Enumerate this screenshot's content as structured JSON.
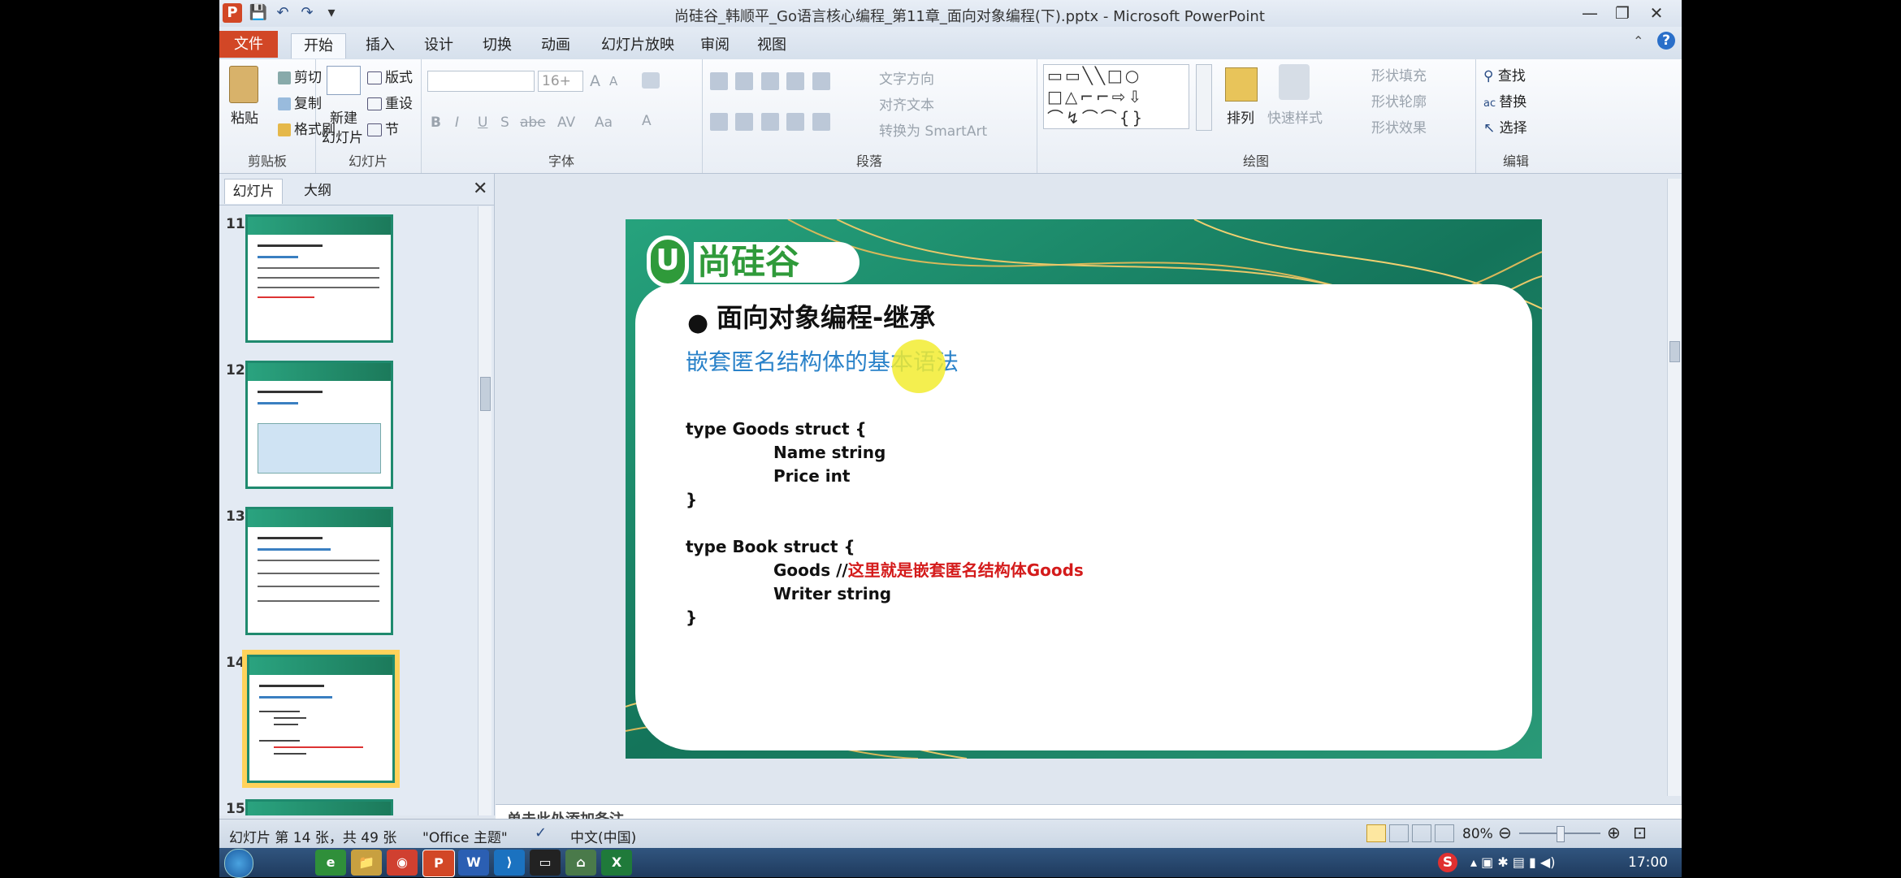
{
  "window": {
    "title": "尚硅谷_韩顺平_Go语言核心编程_第11章_面向对象编程(下).pptx - Microsoft PowerPoint",
    "controls": {
      "minimize": "—",
      "maximize": "❐",
      "close": "✕"
    }
  },
  "quick_access": {
    "app_icon": "P",
    "save": "💾",
    "undo": "↶",
    "redo": "↷",
    "more": "▾"
  },
  "tabs": [
    "文件",
    "开始",
    "插入",
    "设计",
    "切换",
    "动画",
    "幻灯片放映",
    "审阅",
    "视图"
  ],
  "active_tab": "开始",
  "ribbon": {
    "clipboard": {
      "paste": "粘贴",
      "cut": "剪切",
      "copy": "复制",
      "format_painter": "格式刷",
      "label": "剪贴板"
    },
    "slides": {
      "new_slide_1": "新建",
      "new_slide_2": "幻灯片",
      "layout": "版式",
      "reset": "重设",
      "section": "节",
      "label": "幻灯片"
    },
    "font": {
      "size": "16+",
      "grow": "A",
      "shrink": "A",
      "bold": "B",
      "italic": "I",
      "underline": "U",
      "shadow": "S",
      "strike": "abe",
      "spacing": "AV",
      "case": "Aa",
      "color": "A",
      "label": "字体"
    },
    "paragraph": {
      "text_direction": "文字方向",
      "align_text": "对齐文本",
      "smartart": "转换为 SmartArt",
      "label": "段落"
    },
    "drawing": {
      "arrange": "排列",
      "quick_styles": "快速样式",
      "fill": "形状填充",
      "outline": "形状轮廓",
      "effects": "形状效果",
      "label": "绘图"
    },
    "editing": {
      "find": "查找",
      "replace": "替换",
      "select": "选择",
      "label": "编辑"
    }
  },
  "pane_tabs": [
    "幻灯片",
    "大纲"
  ],
  "thumbnails": [
    {
      "num": "11",
      "selected": false,
      "accent": "#3a7fc1"
    },
    {
      "num": "12",
      "selected": false,
      "accent": "#3a7fc1"
    },
    {
      "num": "13",
      "selected": false,
      "accent": "#3a7fc1"
    },
    {
      "num": "14",
      "selected": true,
      "accent": "#e03030"
    },
    {
      "num": "15",
      "selected": false,
      "accent": "#3a7fc1"
    }
  ],
  "slide": {
    "logo": "尚硅谷",
    "logo_letter": "U",
    "bullet": "面向对象编程-继承",
    "subtitle": "嵌套匿名结构体的基本语法",
    "code": [
      {
        "text": "type Goods struct {",
        "indent": 0
      },
      {
        "text": "Name string",
        "indent": 1
      },
      {
        "text": "Price int",
        "indent": 1
      },
      {
        "text": "}",
        "indent": 0
      },
      {
        "text": "",
        "indent": 0
      },
      {
        "text": "type Book struct {",
        "indent": 0
      },
      {
        "text": "Goods  //",
        "indent": 1,
        "comment": "这里就是嵌套匿名结构体Goods"
      },
      {
        "text": "Writer string",
        "indent": 1
      },
      {
        "text": "}",
        "indent": 0
      }
    ],
    "colors": {
      "green": "#1d8f70",
      "blue": "#2a82c9",
      "red": "#d41b1b"
    }
  },
  "notes": "单击此处添加备注",
  "status": {
    "slide_info": "幻灯片 第 14 张，共 49 张",
    "theme": "\"Office 主题\"",
    "language": "中文(中国)",
    "zoom": "80%"
  },
  "taskbar": {
    "apps": [
      "e",
      "📁",
      "◉",
      "P",
      "W",
      "⟩",
      "▭",
      "⌂",
      "X"
    ],
    "time": "17:00"
  }
}
